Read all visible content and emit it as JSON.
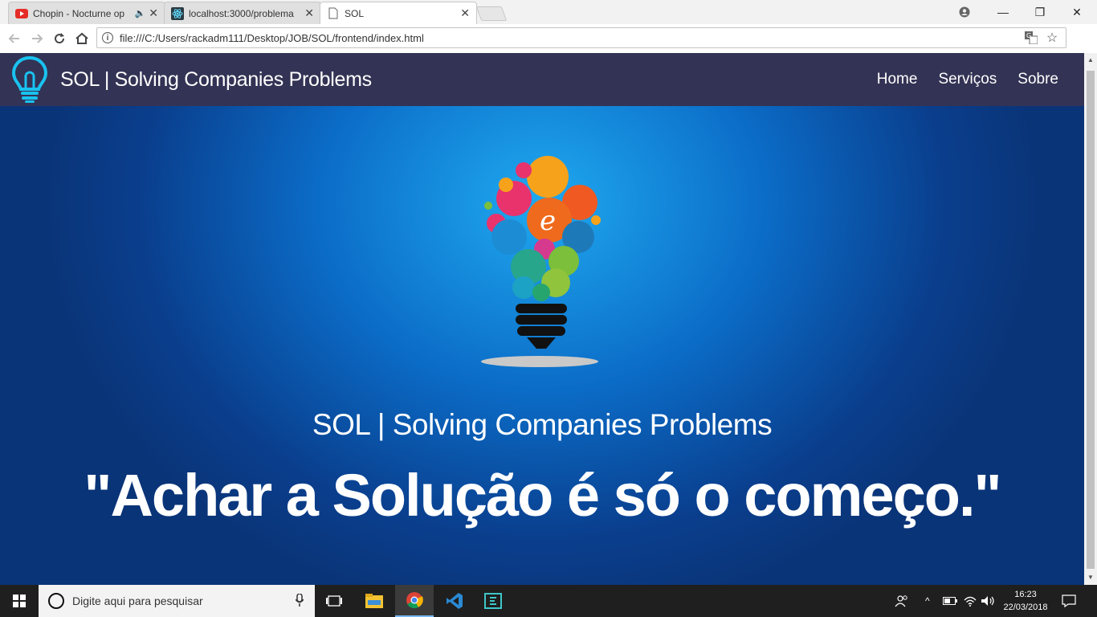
{
  "browser": {
    "tabs": [
      {
        "title": "Chopin - Nocturne op",
        "favicon": "youtube-icon",
        "audio": true
      },
      {
        "title": "localhost:3000/problema",
        "favicon": "react-icon"
      },
      {
        "title": "SOL",
        "favicon": "page-icon",
        "active": true
      }
    ],
    "url": "file:///C:/Users/rackadm111/Desktop/JOB/SOL/frontend/index.html"
  },
  "site": {
    "brand": "SOL | Solving Companies Problems",
    "nav": [
      "Home",
      "Serviços",
      "Sobre"
    ],
    "hero": {
      "subtitle": "SOL | Solving Companies Problems",
      "quote": "\"Achar a Solução é só o começo.\""
    }
  },
  "taskbar": {
    "search_placeholder": "Digite aqui para pesquisar",
    "time": "16:23",
    "date": "22/03/2018"
  },
  "colors": {
    "navbar": "#333355",
    "hero_light": "#1fa9f0",
    "hero_dark": "#0a3478",
    "logo_cyan": "#19c3f0"
  }
}
